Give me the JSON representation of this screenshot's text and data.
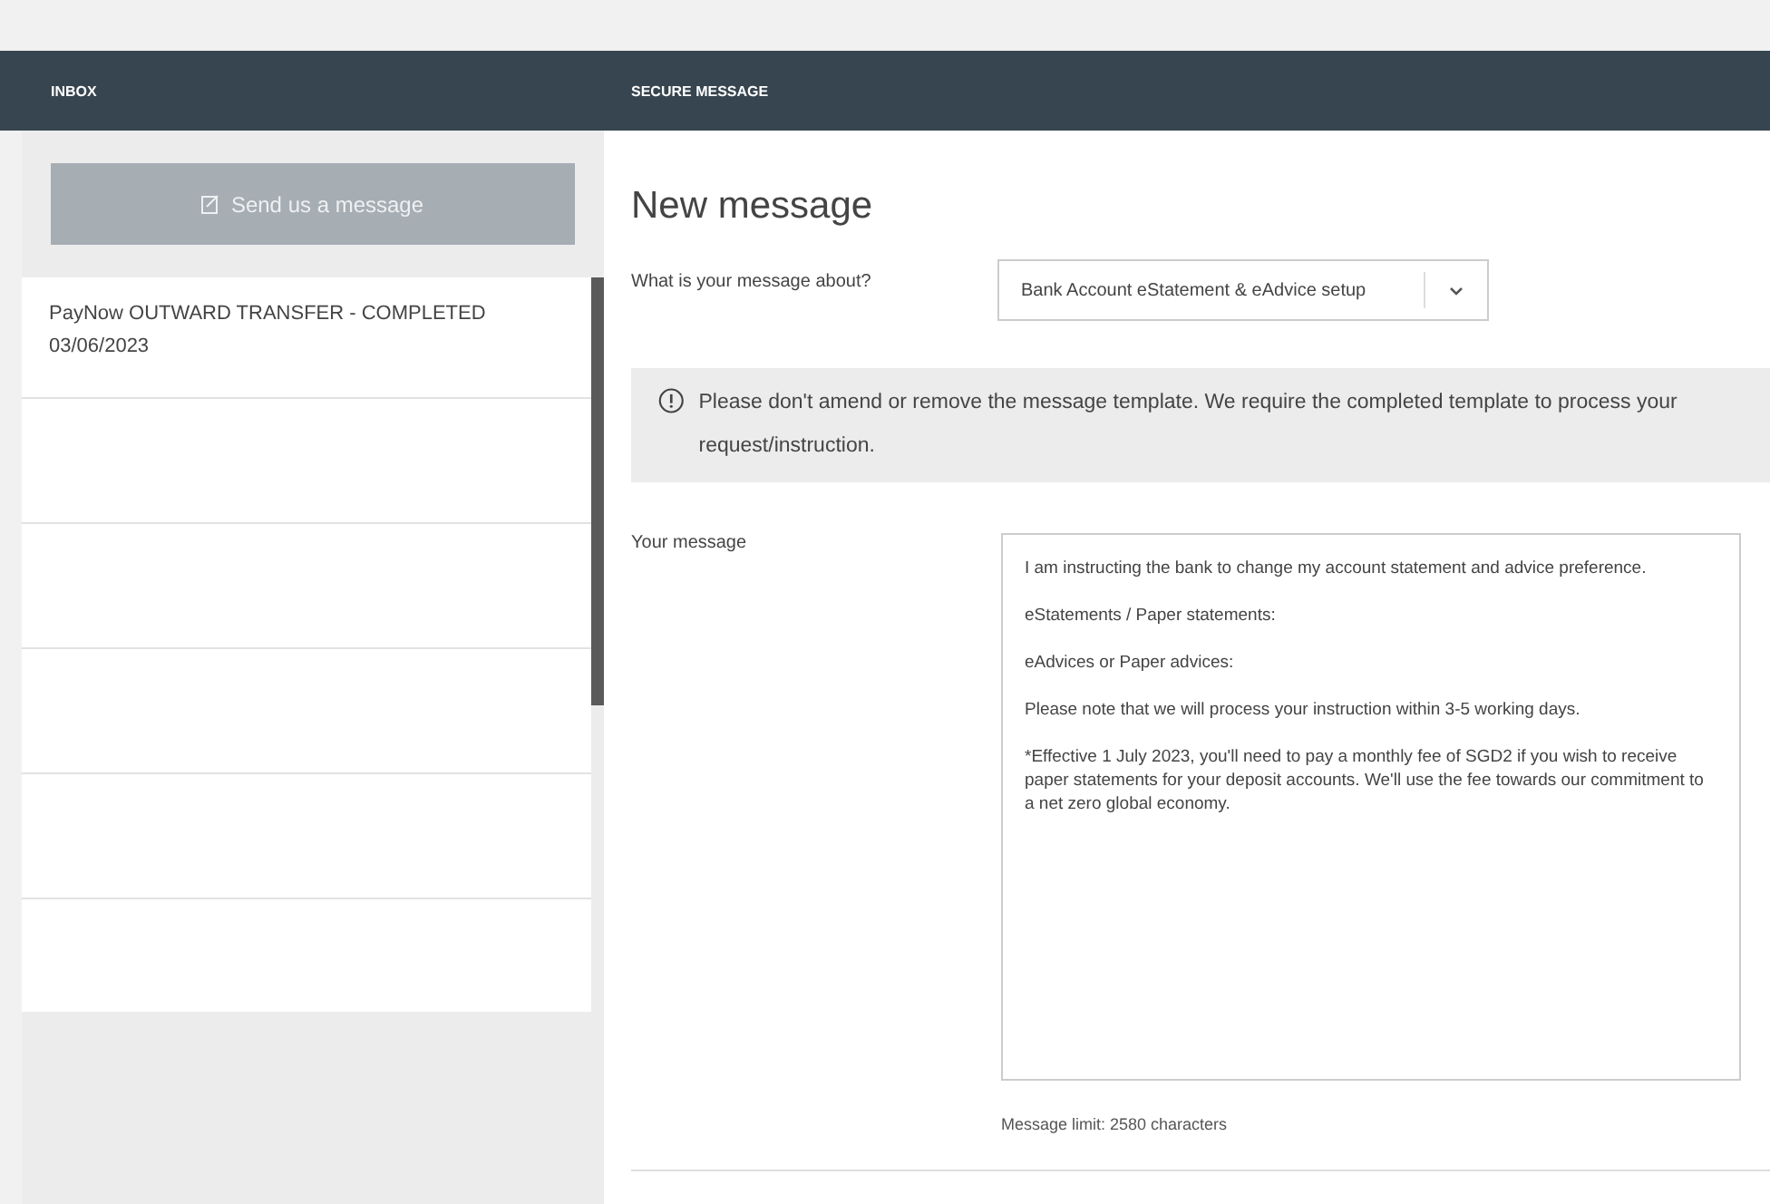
{
  "header": {
    "left_title": "INBOX",
    "right_title": "SECURE MESSAGE"
  },
  "inbox": {
    "compose_button": "Send us a message",
    "items": [
      {
        "subject": "PayNow OUTWARD TRANSFER - COMPLETED",
        "date": "03/06/2023"
      }
    ]
  },
  "form": {
    "title": "New message",
    "topic_label": "What is your message about?",
    "topic_value": "Bank Account eStatement & eAdvice setup",
    "notice": "Please don't amend or remove the message template. We require the completed template to process your request/instruction.",
    "message_label": "Your message",
    "message_value": "I am instructing the bank to change my account statement and advice preference.\n\neStatements / Paper statements:\n\neAdvices or Paper advices:\n\nPlease note that we will process your instruction within 3-5 working days.\n\n*Effective 1 July 2023, you'll need to pay a monthly fee of SGD2 if you wish to receive paper statements for your deposit accounts. We'll use the fee towards our commitment to a net zero global economy.",
    "limit": "Message limit: 2580 characters"
  }
}
